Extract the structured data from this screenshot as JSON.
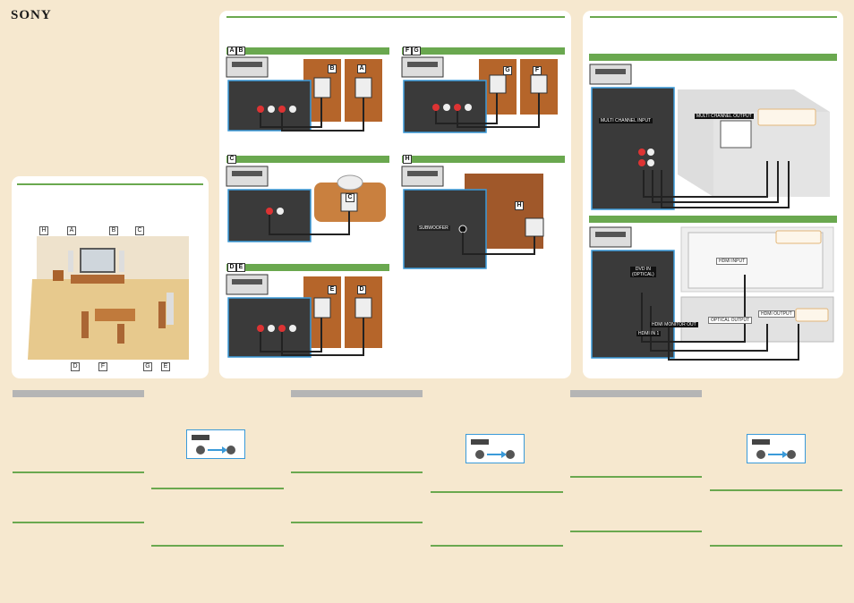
{
  "brand": "SONY",
  "room": {
    "tags": [
      "H",
      "A",
      "B",
      "C",
      "D",
      "F",
      "G",
      "E"
    ]
  },
  "sections": {
    "ab": {
      "tags": [
        "A",
        "B"
      ],
      "speakers": [
        "B",
        "A"
      ]
    },
    "c": {
      "tags": [
        "C"
      ],
      "speakers": [
        "C"
      ]
    },
    "de": {
      "tags": [
        "D",
        "E"
      ],
      "speakers": [
        "E",
        "D"
      ]
    },
    "fg": {
      "tags": [
        "F",
        "G"
      ],
      "speakers": [
        "G",
        "F"
      ]
    },
    "h": {
      "tags": [
        "H"
      ],
      "speakers": [
        "H"
      ],
      "port_label": "SUBWOOFER"
    },
    "multi": {
      "input_label": "MULTI CHANNEL INPUT",
      "output_label": "MULTI CHANNEL OUTPUT"
    },
    "hdmi": {
      "dvd_in_label": "DVD IN\n(OPTICAL)",
      "hdmi_input_label": "HDMI INPUT",
      "hdmi_monitor_out_label": "HDMI MONITOR OUT",
      "hdmi_in_label": "HDMI IN 1",
      "optical_output_label": "OPTICAL OUTPUT",
      "hdmi_output_label": "HDMI OUTPUT"
    }
  },
  "colors": {
    "accent_green": "#6aa84f",
    "background": "#f6e8cf",
    "highlight_blue": "#3a9ad9",
    "speaker_wood": "#b5652a"
  }
}
